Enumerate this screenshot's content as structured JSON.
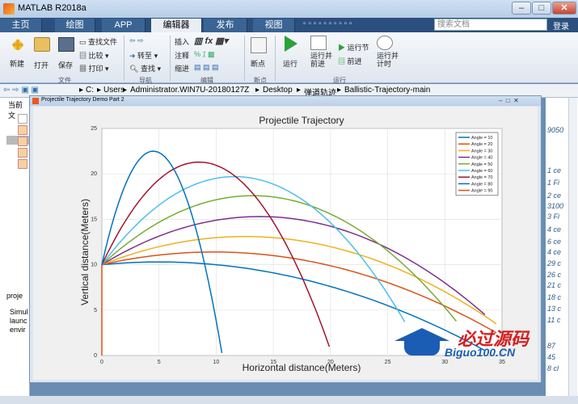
{
  "window": {
    "title": "MATLAB R2018a",
    "min": "–",
    "max": "□",
    "close": "✕"
  },
  "tabs": [
    {
      "label": "主页"
    },
    {
      "label": "绘图"
    },
    {
      "label": "APP"
    },
    {
      "label": "编辑器"
    },
    {
      "label": "发布"
    },
    {
      "label": "视图"
    }
  ],
  "search": {
    "placeholder": "搜索文档"
  },
  "login": "登录",
  "ribbon": {
    "new": "新建",
    "open": "打开",
    "save": "保存",
    "find_files": "查找文件",
    "compare": "比较",
    "print": "打印",
    "goto": "转至",
    "find": "查找",
    "insert": "插入",
    "comment": "注释",
    "indent": "缩进",
    "breakpoints": "断点",
    "run": "运行",
    "run_advance": "运行并\n前进",
    "run_section": "运行节",
    "advance": "前进",
    "run_time": "运行并\n计时",
    "groups": {
      "file": "文件",
      "navigate": "导航",
      "edit": "编辑",
      "breakpoints": "断点",
      "run": "运行"
    }
  },
  "address": {
    "segments": [
      "C:",
      "Users",
      "Administrator.WIN7U-20180127Z",
      "Desktop",
      "弹道轨迹",
      "Ballistic-Trajectory-main"
    ]
  },
  "left_panel": {
    "header": "当前文",
    "console_header": "proje",
    "console_lines": [
      "Simul",
      "launc",
      "envir"
    ]
  },
  "right_panel": {
    "lines": [
      "9050",
      "",
      "1 ce",
      "1 Fi",
      "2 ce",
      "3100",
      "3 Fi",
      "4 ce",
      "6 ce",
      "4 ce",
      "29 c",
      "26 c",
      "21 c",
      "18 c",
      "13 c",
      "11 c",
      "87",
      "45",
      "8 cl"
    ]
  },
  "figure_window": {
    "title": "Projectile Trajectory Demo Part 2"
  },
  "colors": {
    "ribbon_tab_bg": "#2b4f7e",
    "active_tab": "#e9eef5"
  },
  "chart_data": {
    "type": "line",
    "title": "Projectile Trajectory",
    "xlabel": "Horizontal distance(Meters)",
    "ylabel": "Vertical distance(Meters)",
    "xlim": [
      0,
      35
    ],
    "ylim": [
      0,
      25
    ],
    "xticks": [
      0,
      5,
      10,
      15,
      20,
      25,
      30,
      35
    ],
    "yticks": [
      0,
      5,
      10,
      15,
      20,
      25
    ],
    "grid": true,
    "legend_position": "top-right",
    "initial_height": 10,
    "series": [
      {
        "name": "Angle = 10",
        "angle": 10,
        "color": "#0072BD",
        "peak_y": 10.3,
        "peak_x": 5.0,
        "range_x": 33.5
      },
      {
        "name": "Angle = 20",
        "angle": 20,
        "color": "#D95319",
        "peak_y": 11.4,
        "peak_x": 9.8,
        "range_x": 34.5
      },
      {
        "name": "Angle = 30",
        "angle": 30,
        "color": "#EDB120",
        "peak_y": 13.1,
        "peak_x": 12.5,
        "range_x": 34.5
      },
      {
        "name": "Angle = 40",
        "angle": 40,
        "color": "#7E2F8E",
        "peak_y": 15.3,
        "peak_x": 13.8,
        "range_x": 33.5
      },
      {
        "name": "Angle = 50",
        "angle": 50,
        "color": "#77AC30",
        "peak_y": 17.6,
        "peak_x": 13.2,
        "range_x": 31.0
      },
      {
        "name": "Angle = 60",
        "angle": 60,
        "color": "#4DBEEE",
        "peak_y": 19.7,
        "peak_x": 11.6,
        "range_x": 26.5
      },
      {
        "name": "Angle = 70",
        "angle": 70,
        "color": "#A2142F",
        "peak_y": 21.3,
        "peak_x": 8.5,
        "range_x": 19.9
      },
      {
        "name": "Angle = 80",
        "angle": 80,
        "color": "#0072BD",
        "peak_y": 22.5,
        "peak_x": 4.5,
        "range_x": 10.5
      },
      {
        "name": "Angle = 90",
        "angle": 90,
        "color": "#D95319",
        "peak_y": 23.0,
        "peak_x": 0.0,
        "range_x": 0.0
      }
    ]
  },
  "watermark": {
    "text": "必过源码",
    "sub": "Biguo100.CN"
  }
}
